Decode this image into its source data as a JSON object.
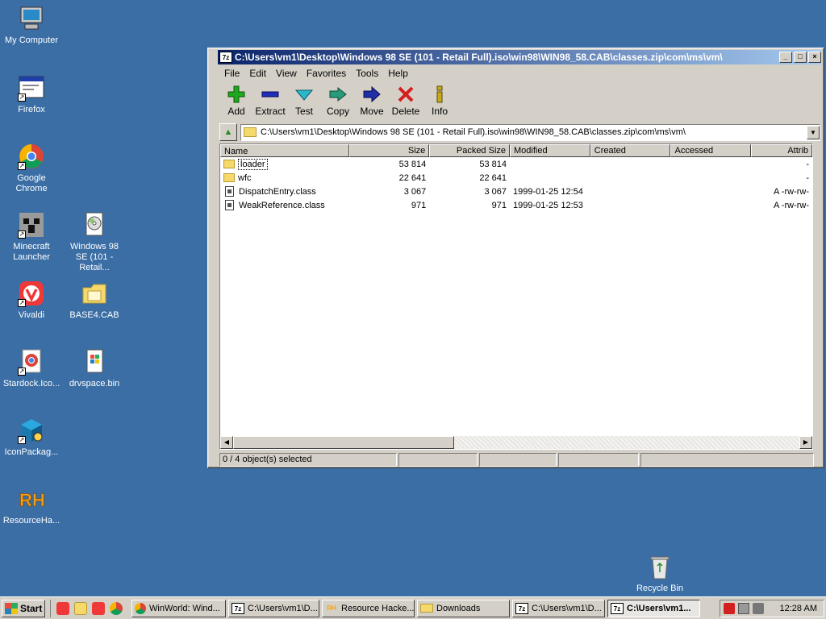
{
  "desktop": {
    "icons": [
      {
        "label": "My Computer"
      },
      {
        "label": "Firefox"
      },
      {
        "label": "Google Chrome"
      },
      {
        "label": "Minecraft Launcher"
      },
      {
        "label": "Windows 98 SE (101 - Retail..."
      },
      {
        "label": "Vivaldi"
      },
      {
        "label": "BASE4.CAB"
      },
      {
        "label": "Stardock.Ico..."
      },
      {
        "label": "drvspace.bin"
      },
      {
        "label": "IconPackag..."
      },
      {
        "label": "ResourceHa..."
      },
      {
        "label": "Recycle Bin"
      }
    ]
  },
  "window": {
    "title": "C:\\Users\\vm1\\Desktop\\Windows 98 SE (101 - Retail Full).iso\\win98\\WIN98_58.CAB\\classes.zip\\com\\ms\\vm\\",
    "app_icon": "7z",
    "menu": [
      "File",
      "Edit",
      "View",
      "Favorites",
      "Tools",
      "Help"
    ],
    "toolbar": [
      {
        "label": "Add",
        "icon": "plus-icon",
        "color": "#1fa81f"
      },
      {
        "label": "Extract",
        "icon": "minus-icon",
        "color": "#1f2fb8"
      },
      {
        "label": "Test",
        "icon": "check-icon",
        "color": "#2ab8c8"
      },
      {
        "label": "Copy",
        "icon": "double-arrow-icon",
        "color": "#2a9a7a"
      },
      {
        "label": "Move",
        "icon": "arrow-right-icon",
        "color": "#1f2fa8"
      },
      {
        "label": "Delete",
        "icon": "x-icon",
        "color": "#d41f1f"
      },
      {
        "label": "Info",
        "icon": "info-icon",
        "color": "#c8a81f"
      }
    ],
    "address": "C:\\Users\\vm1\\Desktop\\Windows 98 SE (101 - Retail Full).iso\\win98\\WIN98_58.CAB\\classes.zip\\com\\ms\\vm\\",
    "columns": [
      "Name",
      "Size",
      "Packed Size",
      "Modified",
      "Created",
      "Accessed",
      "Attrib"
    ],
    "rows": [
      {
        "name": "loader",
        "type": "folder",
        "size": "53 814",
        "packed": "53 814",
        "modified": "",
        "created": "",
        "accessed": "",
        "attrib": "-"
      },
      {
        "name": "wfc",
        "type": "folder",
        "size": "22 641",
        "packed": "22 641",
        "modified": "",
        "created": "",
        "accessed": "",
        "attrib": "-"
      },
      {
        "name": "DispatchEntry.class",
        "type": "file",
        "size": "3 067",
        "packed": "3 067",
        "modified": "1999-01-25 12:54",
        "created": "",
        "accessed": "",
        "attrib": "A -rw-rw-"
      },
      {
        "name": "WeakReference.class",
        "type": "file",
        "size": "971",
        "packed": "971",
        "modified": "1999-01-25 12:53",
        "created": "",
        "accessed": "",
        "attrib": "A -rw-rw-"
      }
    ],
    "status": [
      "0 / 4 object(s) selected",
      "",
      "",
      "",
      ""
    ]
  },
  "taskbar": {
    "start_label": "Start",
    "tasks": [
      {
        "label": "WinWorld: Wind...",
        "icon": "chrome-icon",
        "active": false
      },
      {
        "label": "C:\\Users\\vm1\\D...",
        "icon": "7zip-icon",
        "active": false
      },
      {
        "label": "Resource Hacke...",
        "icon": "resourcehacker-icon",
        "active": false
      },
      {
        "label": "Downloads",
        "icon": "folder-icon",
        "active": false
      },
      {
        "label": "C:\\Users\\vm1\\D...",
        "icon": "7zip-icon",
        "active": false
      },
      {
        "label": "C:\\Users\\vm1...",
        "icon": "7zip-icon",
        "active": true
      }
    ],
    "clock": "12:28 AM"
  },
  "colors": {
    "desktop": "#3a6ea5",
    "title_start": "#0a246a",
    "title_end": "#a6caf0",
    "face": "#d4d0c8"
  }
}
